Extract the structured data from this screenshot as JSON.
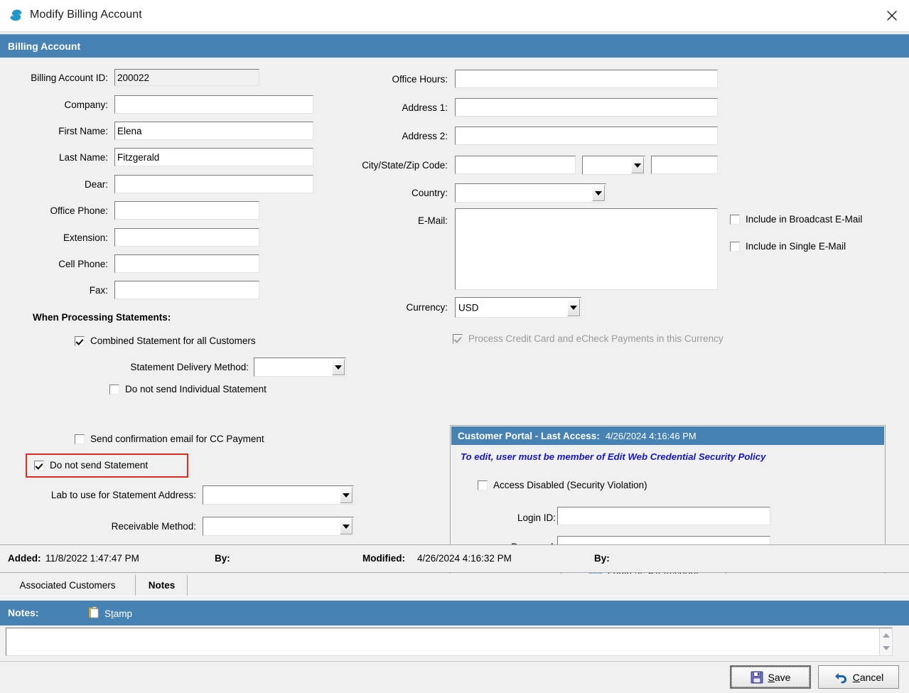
{
  "window": {
    "title": "Modify Billing Account",
    "app_icon": "swirl-logo-icon",
    "close_icon": "close-icon"
  },
  "section": {
    "header": "Billing Account"
  },
  "left_form": {
    "fields": [
      {
        "label": "Billing Account ID:",
        "value": "200022",
        "readonly": true
      },
      {
        "label": "Company:",
        "value": "",
        "readonly": false
      },
      {
        "label": "First Name:",
        "value": "Elena",
        "readonly": false
      },
      {
        "label": "Last Name:",
        "value": "Fitzgerald",
        "readonly": false
      },
      {
        "label": "Dear:",
        "value": "",
        "readonly": false
      },
      {
        "label": "Office Phone:",
        "value": "",
        "readonly": false
      },
      {
        "label": "Extension:",
        "value": "",
        "readonly": false
      },
      {
        "label": "Cell Phone:",
        "value": "",
        "readonly": false
      },
      {
        "label": "Fax:",
        "value": "",
        "readonly": false
      }
    ]
  },
  "right_form": {
    "office_hours_label": "Office Hours:",
    "office_hours_value": "",
    "address1_label": "Address 1:",
    "address1_value": "",
    "address2_label": "Address 2:",
    "address2_value": "",
    "city_state_zip_label": "City/State/Zip Code:",
    "city_value": "",
    "state_value": "",
    "zip_value": "",
    "country_label": "Country:",
    "country_value": "",
    "email_label": "E-Mail:",
    "email_value": "",
    "include_broadcast_label": "Include in Broadcast E-Mail",
    "include_broadcast_checked": false,
    "include_single_label": "Include in Single E-Mail",
    "include_single_checked": false,
    "currency_label": "Currency:",
    "currency_value": "USD",
    "process_cc_label": "Process Credit Card and eCheck Payments in this Currency",
    "process_cc_checked": true,
    "process_cc_disabled": true
  },
  "statements": {
    "heading": "When Processing Statements:",
    "combined_label": "Combined Statement for all Customers",
    "combined_checked": true,
    "delivery_method_label": "Statement Delivery Method:",
    "delivery_method_value": "",
    "no_individual_label": "Do not send Individual Statement",
    "no_individual_checked": false,
    "send_confirmation_label": "Send confirmation email for CC Payment",
    "send_confirmation_checked": false,
    "do_not_send_label": "Do not send Statement",
    "do_not_send_checked": true,
    "do_not_send_highlight_color": "#e02b20",
    "lab_address_label": "Lab to use for Statement Address:",
    "lab_address_value": "",
    "receivable_method_label": "Receivable Method:",
    "receivable_method_value": ""
  },
  "portal": {
    "title": "Customer Portal - Last Access:",
    "last_access": "4/26/2024 4:16:46 PM",
    "note": "To edit, user must be member of Edit Web Credential Security Policy",
    "access_disabled_label": "Access Disabled (Security Violation)",
    "access_disabled_checked": false,
    "login_id_label": "Login ID:",
    "login_id_value": "",
    "password_label": "Password:",
    "password_value": "",
    "login_button_label": "Login as BA Account",
    "login_button_icon": "globe-icon"
  },
  "status": {
    "added_label": "Added:",
    "added_value": "11/8/2022 1:47:47 PM",
    "added_by_label": "By:",
    "added_by_value": "",
    "modified_label": "Modified:",
    "modified_value": "4/26/2024 4:16:32 PM",
    "modified_by_label": "By:",
    "modified_by_value": ""
  },
  "tabs": [
    {
      "label": "Associated Customers",
      "active": false
    },
    {
      "label": "Notes",
      "active": true
    }
  ],
  "notes": {
    "label": "Notes:",
    "stamp_label": "Stamp",
    "stamp_icon": "clipboard-icon",
    "value": "",
    "scroll_up_icon": "triangle-up-icon",
    "scroll_down_icon": "triangle-down-icon"
  },
  "footer": {
    "save_label": "Save",
    "save_icon": "floppy-disk-icon",
    "cancel_label": "Cancel",
    "cancel_icon": "undo-arrow-icon"
  },
  "colors": {
    "header_blue": "#4782B5",
    "highlight_red": "#e02b20",
    "note_blue": "#1414d2",
    "window_bg": "#f0f0f0"
  }
}
